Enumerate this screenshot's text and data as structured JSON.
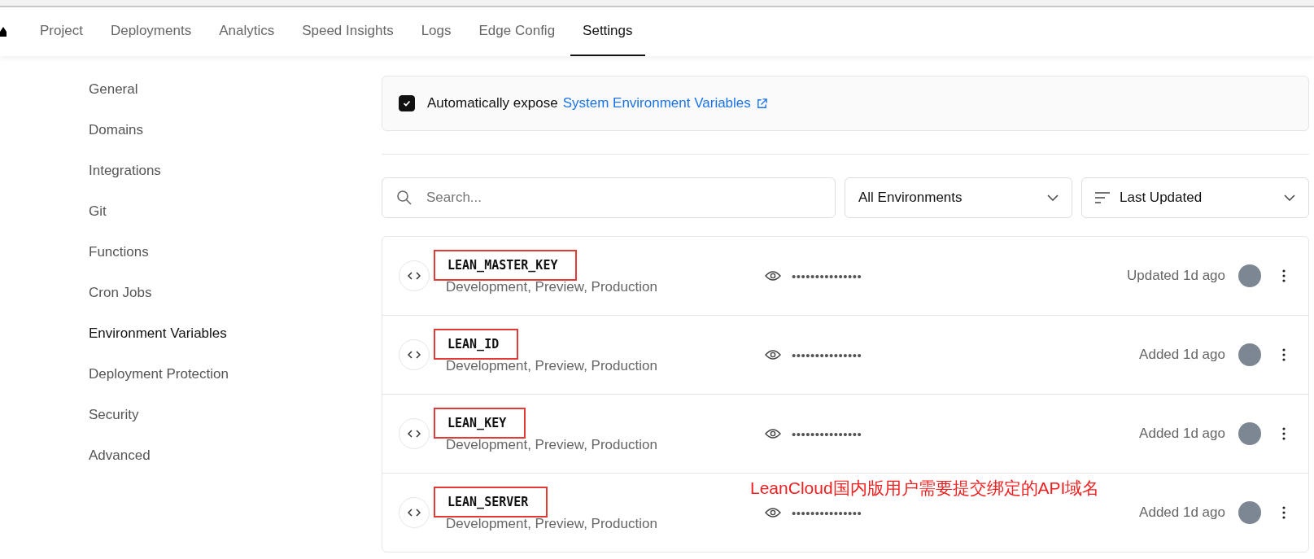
{
  "nav": {
    "tabs": [
      {
        "label": "Project",
        "selected": false
      },
      {
        "label": "Deployments",
        "selected": false
      },
      {
        "label": "Analytics",
        "selected": false
      },
      {
        "label": "Speed Insights",
        "selected": false
      },
      {
        "label": "Logs",
        "selected": false
      },
      {
        "label": "Edge Config",
        "selected": false
      },
      {
        "label": "Settings",
        "selected": true
      }
    ]
  },
  "sidebar": {
    "items": [
      {
        "label": "General",
        "selected": false
      },
      {
        "label": "Domains",
        "selected": false
      },
      {
        "label": "Integrations",
        "selected": false
      },
      {
        "label": "Git",
        "selected": false
      },
      {
        "label": "Functions",
        "selected": false
      },
      {
        "label": "Cron Jobs",
        "selected": false
      },
      {
        "label": "Environment Variables",
        "selected": true
      },
      {
        "label": "Deployment Protection",
        "selected": false
      },
      {
        "label": "Security",
        "selected": false
      },
      {
        "label": "Advanced",
        "selected": false
      }
    ]
  },
  "expose": {
    "checked": true,
    "text": "Automatically expose",
    "link": "System Environment Variables"
  },
  "search": {
    "placeholder": "Search..."
  },
  "environment_filter": {
    "value": "All Environments"
  },
  "sort": {
    "value": "Last Updated"
  },
  "variables": [
    {
      "name": "LEAN_MASTER_KEY",
      "environments": "Development, Preview, Production",
      "value": "•••••••••••••••",
      "updated": "Updated 1d ago",
      "highlighted": true
    },
    {
      "name": "LEAN_ID",
      "environments": "Development, Preview, Production",
      "value": "•••••••••••••••",
      "updated": "Added 1d ago",
      "highlighted": true
    },
    {
      "name": "LEAN_KEY",
      "environments": "Development, Preview, Production",
      "value": "•••••••••••••••",
      "updated": "Added 1d ago",
      "highlighted": true
    },
    {
      "name": "LEAN_SERVER",
      "environments": "Development, Preview, Production",
      "value": "•••••••••••••••",
      "updated": "Added 1d ago",
      "highlighted": true,
      "note": "LeanCloud国内版用户需要提交绑定的API域名"
    }
  ]
}
